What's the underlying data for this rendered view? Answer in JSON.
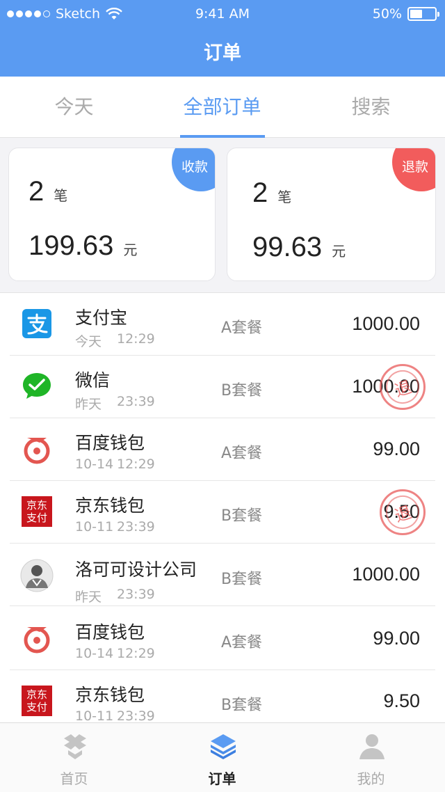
{
  "status_bar": {
    "carrier": "Sketch",
    "time": "9:41 AM",
    "battery": "50%",
    "battery_level": 0.5
  },
  "nav": {
    "title": "订单"
  },
  "tabs": [
    {
      "label": "今天"
    },
    {
      "label": "全部订单"
    },
    {
      "label": "搜索"
    }
  ],
  "active_tab": "全部订单",
  "summary": {
    "income": {
      "badge": "收款",
      "count": "2",
      "count_unit": "笔",
      "amount": "199.63",
      "amount_unit": "元"
    },
    "refund": {
      "badge": "退款",
      "count": "2",
      "count_unit": "笔",
      "amount": "99.63",
      "amount_unit": "元"
    }
  },
  "orders": [
    {
      "name": "支付宝",
      "date": "今天",
      "time": "12:29",
      "package": "A套餐",
      "amount": "1000.00",
      "icon": "alipay-icon",
      "refunded": false
    },
    {
      "name": "微信",
      "date": "昨天",
      "time": "23:39",
      "package": "B套餐",
      "amount": "1000.00",
      "icon": "wechat-pay-icon",
      "refunded": true,
      "stamp": "退"
    },
    {
      "name": "百度钱包",
      "date": "10-14",
      "time": "12:29",
      "package": "A套餐",
      "amount": "99.00",
      "icon": "baidu-wallet-icon",
      "refunded": false
    },
    {
      "name": "京东钱包",
      "date": "10-11",
      "time": "23:39",
      "package": "B套餐",
      "amount": "9.50",
      "icon": "jd-pay-icon",
      "refunded": true,
      "stamp": "退",
      "logo_text": [
        "京东",
        "支付"
      ]
    },
    {
      "name": "洛可可设计公司",
      "date": "昨天",
      "time": "23:39",
      "package": "B套餐",
      "amount": "1000.00",
      "icon": "avatar-icon",
      "refunded": false
    },
    {
      "name": "百度钱包",
      "date": "10-14",
      "time": "12:29",
      "package": "A套餐",
      "amount": "99.00",
      "icon": "baidu-wallet-icon",
      "refunded": false
    },
    {
      "name": "京东钱包",
      "date": "10-11",
      "time": "23:39",
      "package": "B套餐",
      "amount": "9.50",
      "icon": "jd-pay-icon",
      "refunded": false,
      "logo_text": [
        "京东",
        "支付"
      ]
    }
  ],
  "tabbar": [
    {
      "label": "首页",
      "icon": "home-box-icon"
    },
    {
      "label": "订单",
      "icon": "layers-icon"
    },
    {
      "label": "我的",
      "icon": "profile-icon"
    }
  ],
  "active_tabbar": "订单",
  "colors": {
    "primary": "#5a9bf2",
    "refund": "#f25c5c",
    "alipay": "#1a97e6",
    "wechat": "#1fb527",
    "baidu": "#e35650",
    "jd": "#c8161d"
  }
}
